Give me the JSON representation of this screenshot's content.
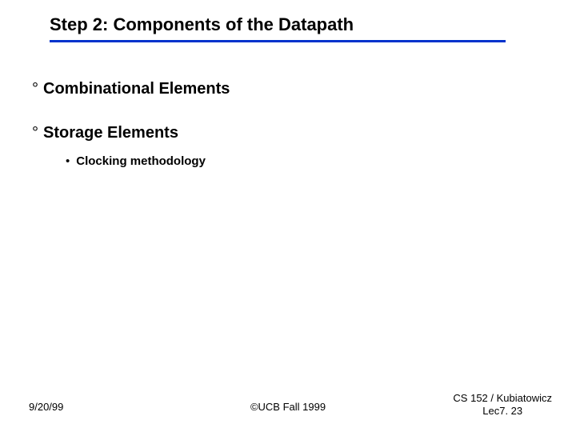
{
  "title": "Step 2: Components of the Datapath",
  "bullets": {
    "b1": "Combinational Elements",
    "b2": "Storage Elements",
    "b2_sub1": "Clocking methodology"
  },
  "footer": {
    "left": "9/20/99",
    "center": "©UCB Fall 1999",
    "right_line1": "CS 152 / Kubiatowicz",
    "right_line2": "Lec7. 23"
  }
}
